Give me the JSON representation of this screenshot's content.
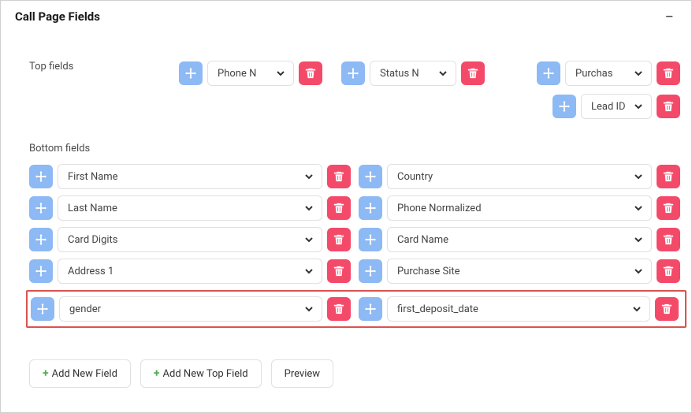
{
  "panel": {
    "title": "Call Page Fields"
  },
  "sections": {
    "top_label": "Top fields",
    "bottom_label": "Bottom fields"
  },
  "top_fields": {
    "row1": [
      {
        "label": "Phone N"
      },
      {
        "label": "Status N"
      },
      {
        "label": "Purchas"
      }
    ],
    "row2": [
      {
        "label": "Lead ID"
      }
    ]
  },
  "bottom_fields": [
    {
      "left": "First Name",
      "right": "Country",
      "highlight": false
    },
    {
      "left": "Last Name",
      "right": "Phone Normalized",
      "highlight": false
    },
    {
      "left": "Card Digits",
      "right": "Card Name",
      "highlight": false
    },
    {
      "left": "Address 1",
      "right": "Purchase Site",
      "highlight": false
    },
    {
      "left": "gender",
      "right": "first_deposit_date",
      "highlight": true
    }
  ],
  "buttons": {
    "add_new_field": "Add New Field",
    "add_new_top_field": "Add New Top Field",
    "preview": "Preview"
  }
}
